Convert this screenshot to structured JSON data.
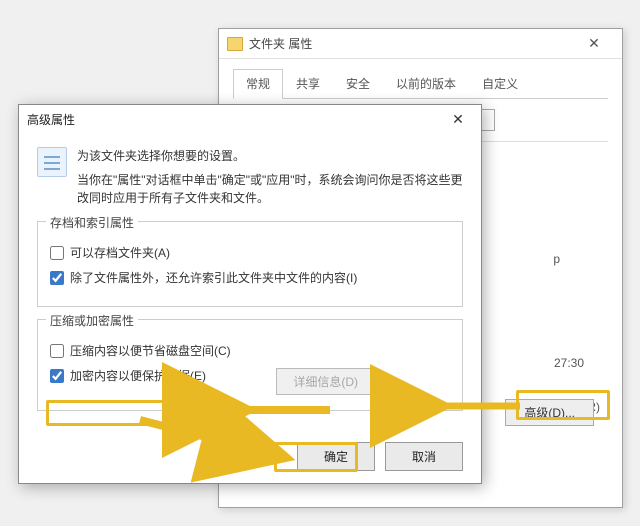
{
  "parent_window": {
    "title": "文件夹 属性",
    "tabs": [
      "常规",
      "共享",
      "安全",
      "以前的版本",
      "自定义"
    ],
    "active_tab": 0,
    "visible_suffix_1": "p",
    "visible_suffix_2": "27:30",
    "visible_suffix_3": "中的文件)(R)",
    "advanced_button": "高级(D)..."
  },
  "child_dialog": {
    "title": "高级属性",
    "info_line1": "为该文件夹选择你想要的设置。",
    "info_line2": "当你在\"属性\"对话框中单击\"确定\"或\"应用\"时，系统会询问你是否将这些更改同时应用于所有子文件夹和文件。",
    "group1": {
      "legend": "存档和索引属性",
      "cb1": {
        "label": "可以存档文件夹(A)",
        "checked": false
      },
      "cb2": {
        "label": "除了文件属性外，还允许索引此文件夹中文件的内容(I)",
        "checked": true
      }
    },
    "group2": {
      "legend": "压缩或加密属性",
      "cb1": {
        "label": "压缩内容以便节省磁盘空间(C)",
        "checked": false
      },
      "cb2": {
        "label": "加密内容以便保护数据(E)",
        "checked": true
      },
      "details_btn": "详细信息(D)"
    },
    "ok": "确定",
    "cancel": "取消"
  }
}
